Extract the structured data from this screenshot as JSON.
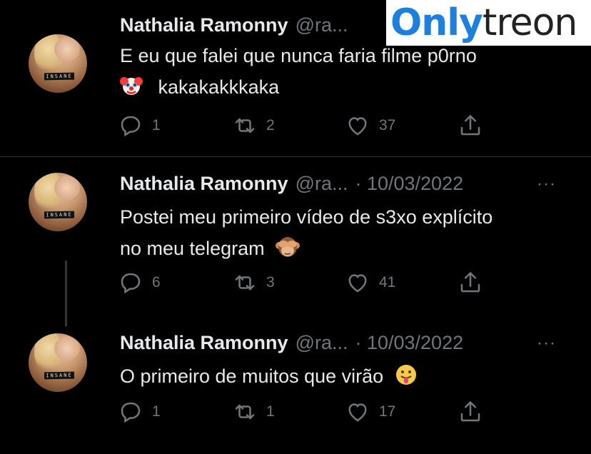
{
  "watermark": {
    "part1": "Only",
    "part2": "treon"
  },
  "tweets": [
    {
      "name": "Nathalia Ramonny",
      "handle": "@ra...",
      "date": "",
      "more": "···",
      "line1": "E eu que falei que nunca faria filme p0rno",
      "emoji": "clown-face",
      "line2": "kakakakkkaka",
      "replies": "1",
      "retweets": "2",
      "likes": "37"
    },
    {
      "name": "Nathalia Ramonny",
      "handle": "@ra...",
      "date": "· 10/03/2022",
      "more": "···",
      "line1": "Postei meu primeiro vídeo de s3xo explícito",
      "line2": "no meu telegram",
      "emoji": "see-no-evil-monkey",
      "replies": "6",
      "retweets": "3",
      "likes": "41"
    },
    {
      "name": "Nathalia Ramonny",
      "handle": "@ra...",
      "date": "· 10/03/2022",
      "more": "···",
      "line1": "O primeiro de muitos que virão",
      "emoji": "face-with-tongue",
      "replies": "1",
      "retweets": "1",
      "likes": "17"
    }
  ],
  "avatar_label": "INSANE",
  "colors": {
    "background": "#000000",
    "text": "#e7e9ea",
    "muted": "#71767b",
    "divider": "#2f3336",
    "watermark_blue": "#1d7fe0"
  }
}
